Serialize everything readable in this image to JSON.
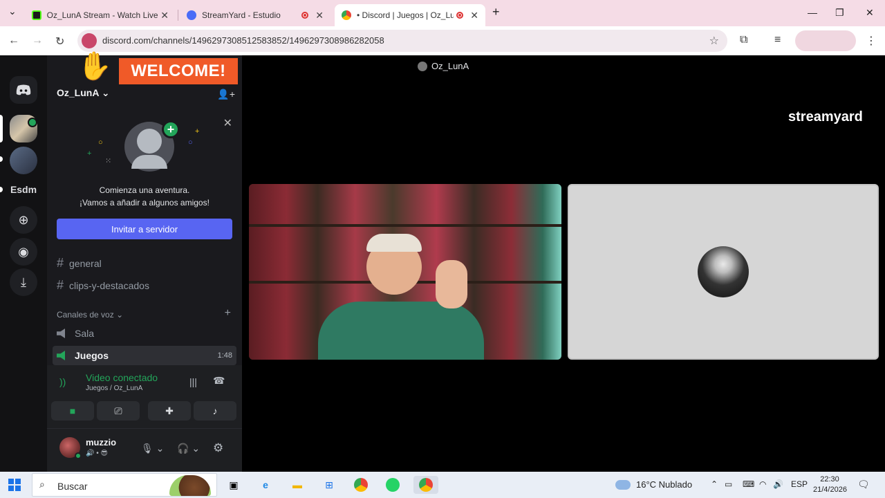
{
  "browser": {
    "tabs": [
      {
        "title": "Oz_LunA Stream - Watch Live o",
        "active": false
      },
      {
        "title": "StreamYard - Estudio",
        "active": false
      },
      {
        "title": "• Discord | Juegos | Oz_Lun",
        "active": true
      }
    ],
    "new_tab": "+",
    "url": "discord.com/channels/1496297308512583852/1496297308986282058"
  },
  "overlay": {
    "welcome": "WELCOME!",
    "streamyard_logo": "streamyard"
  },
  "discord": {
    "server_rail": {
      "text_server": "Esdm"
    },
    "server_name": "Oz_LunA",
    "server_chevron": "⌄",
    "invite_card": {
      "line1": "Comienza una aventura.",
      "line2": "¡Vamos a añadir a algunos amigos!",
      "button": "Invitar a servidor"
    },
    "text_channels": [
      "general",
      "clips-y-destacados"
    ],
    "voice_category": "Canales de voz",
    "voice_channels": [
      {
        "name": "Sala",
        "active": false,
        "time": ""
      },
      {
        "name": "Juegos",
        "active": true,
        "time": "1:48"
      }
    ],
    "voice_panel": {
      "title": "Video conectado",
      "subtitle": "Juegos / Oz_LunA"
    },
    "user": {
      "name": "muzzio",
      "status": "🔊 • 😎"
    },
    "call": {
      "title": "Oz_LunA"
    }
  },
  "taskbar": {
    "search_placeholder": "Buscar",
    "weather": "16°C  Nublado",
    "lang": "ESP",
    "time": "22:30",
    "date": "21/4/2026"
  },
  "colors": {
    "blurple": "#5865f2",
    "green": "#23a55a",
    "welcome_orange": "#f05a28"
  }
}
